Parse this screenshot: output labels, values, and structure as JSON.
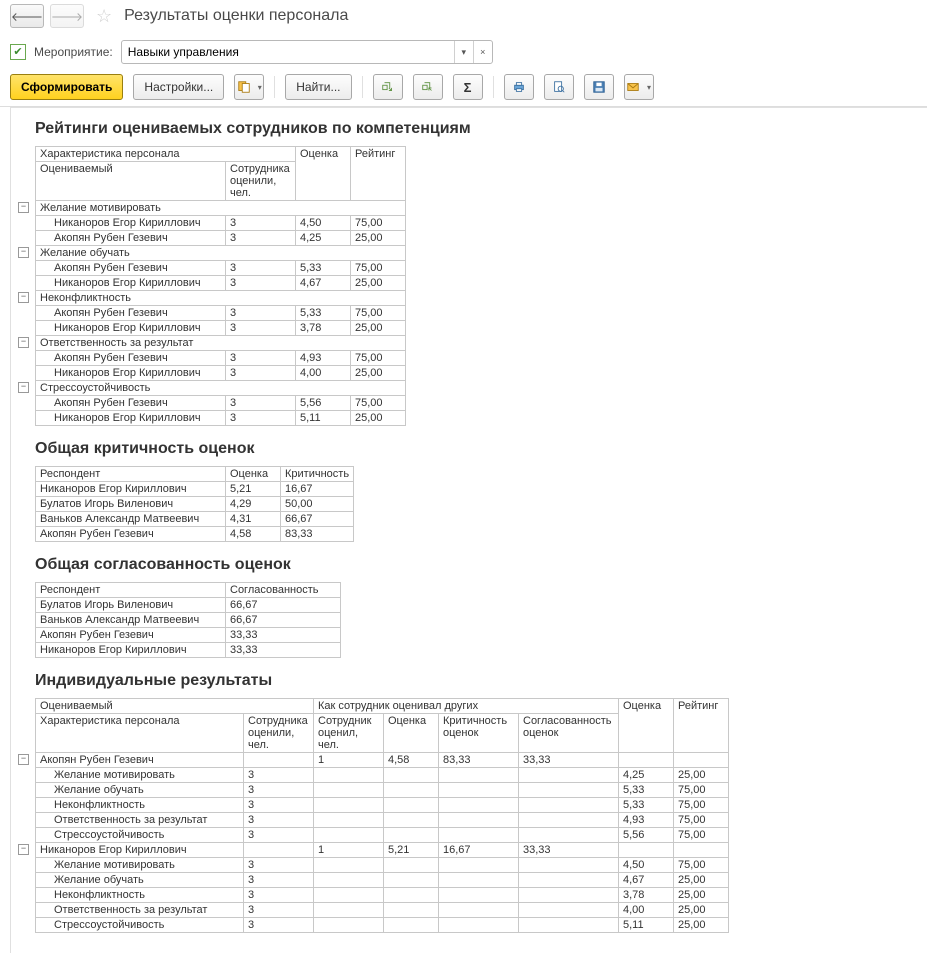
{
  "header": {
    "title": "Результаты оценки персонала"
  },
  "filter": {
    "label": "Мероприятие:",
    "value": "Навыки управления"
  },
  "toolbar": {
    "form": "Сформировать",
    "settings": "Настройки...",
    "find": "Найти..."
  },
  "section1": {
    "title": "Рейтинги оцениваемых сотрудников по компетенциям",
    "h_char": "Характеристика персонала",
    "h_eval": "Оцениваемый",
    "h_people": "Сотрудника\nоценили,\nчел.",
    "h_score": "Оценка",
    "h_rating": "Рейтинг",
    "groups": [
      {
        "name": "Желание мотивировать",
        "rows": [
          {
            "name": "Никаноров Егор Кириллович",
            "cnt": "3",
            "score": "4,50",
            "rating": "75,00"
          },
          {
            "name": "Акопян Рубен Гезевич",
            "cnt": "3",
            "score": "4,25",
            "rating": "25,00"
          }
        ]
      },
      {
        "name": "Желание обучать",
        "rows": [
          {
            "name": "Акопян Рубен Гезевич",
            "cnt": "3",
            "score": "5,33",
            "rating": "75,00"
          },
          {
            "name": "Никаноров Егор Кириллович",
            "cnt": "3",
            "score": "4,67",
            "rating": "25,00"
          }
        ]
      },
      {
        "name": "Неконфликтность",
        "rows": [
          {
            "name": "Акопян Рубен Гезевич",
            "cnt": "3",
            "score": "5,33",
            "rating": "75,00"
          },
          {
            "name": "Никаноров Егор Кириллович",
            "cnt": "3",
            "score": "3,78",
            "rating": "25,00"
          }
        ]
      },
      {
        "name": "Ответственность за результат",
        "rows": [
          {
            "name": "Акопян Рубен Гезевич",
            "cnt": "3",
            "score": "4,93",
            "rating": "75,00"
          },
          {
            "name": "Никаноров Егор Кириллович",
            "cnt": "3",
            "score": "4,00",
            "rating": "25,00"
          }
        ]
      },
      {
        "name": "Стрессоустойчивость",
        "rows": [
          {
            "name": "Акопян Рубен Гезевич",
            "cnt": "3",
            "score": "5,56",
            "rating": "75,00"
          },
          {
            "name": "Никаноров Егор Кириллович",
            "cnt": "3",
            "score": "5,11",
            "rating": "25,00"
          }
        ]
      }
    ]
  },
  "section2": {
    "title": "Общая критичность оценок",
    "h_resp": "Респондент",
    "h_score": "Оценка",
    "h_crit": "Критичность",
    "rows": [
      {
        "name": "Никаноров Егор Кириллович",
        "score": "5,21",
        "crit": "16,67"
      },
      {
        "name": "Булатов Игорь Виленович",
        "score": "4,29",
        "crit": "50,00"
      },
      {
        "name": "Ваньков Александр Матвеевич",
        "score": "4,31",
        "crit": "66,67"
      },
      {
        "name": "Акопян Рубен Гезевич",
        "score": "4,58",
        "crit": "83,33"
      }
    ]
  },
  "section3": {
    "title": "Общая согласованность оценок",
    "h_resp": "Респондент",
    "h_cons": "Согласованность",
    "rows": [
      {
        "name": "Булатов Игорь Виленович",
        "cons": "66,67"
      },
      {
        "name": "Ваньков Александр Матвеевич",
        "cons": "66,67"
      },
      {
        "name": "Акопян Рубен Гезевич",
        "cons": "33,33"
      },
      {
        "name": "Никаноров Егор Кириллович",
        "cons": "33,33"
      }
    ]
  },
  "section4": {
    "title": "Индивидуальные результаты",
    "h_evaluated": "Оцениваемый",
    "h_others": "Как сотрудник оценивал других",
    "h_char": "Характеристика персонала",
    "h_people_rated": "Сотрудника\nоценили,\nчел.",
    "h_rated_people": "Сотрудник\nоценил, чел.",
    "h_score_o": "Оценка",
    "h_crit": "Критичность\nоценок",
    "h_cons": "Согласованность\nоценок",
    "h_score": "Оценка",
    "h_rating": "Рейтинг",
    "groups": [
      {
        "name": "Акопян Рубен Гезевич",
        "rated_people": "1",
        "score_o": "4,58",
        "crit": "83,33",
        "cons": "33,33",
        "rows": [
          {
            "name": "Желание мотивировать",
            "cnt": "3",
            "score": "4,25",
            "rating": "25,00"
          },
          {
            "name": "Желание обучать",
            "cnt": "3",
            "score": "5,33",
            "rating": "75,00"
          },
          {
            "name": "Неконфликтность",
            "cnt": "3",
            "score": "5,33",
            "rating": "75,00"
          },
          {
            "name": "Ответственность за результат",
            "cnt": "3",
            "score": "4,93",
            "rating": "75,00"
          },
          {
            "name": "Стрессоустойчивость",
            "cnt": "3",
            "score": "5,56",
            "rating": "75,00"
          }
        ]
      },
      {
        "name": "Никаноров Егор Кириллович",
        "rated_people": "1",
        "score_o": "5,21",
        "crit": "16,67",
        "cons": "33,33",
        "rows": [
          {
            "name": "Желание мотивировать",
            "cnt": "3",
            "score": "4,50",
            "rating": "75,00"
          },
          {
            "name": "Желание обучать",
            "cnt": "3",
            "score": "4,67",
            "rating": "25,00"
          },
          {
            "name": "Неконфликтность",
            "cnt": "3",
            "score": "3,78",
            "rating": "25,00"
          },
          {
            "name": "Ответственность за результат",
            "cnt": "3",
            "score": "4,00",
            "rating": "25,00"
          },
          {
            "name": "Стрессоустойчивость",
            "cnt": "3",
            "score": "5,11",
            "rating": "25,00"
          }
        ]
      }
    ]
  }
}
